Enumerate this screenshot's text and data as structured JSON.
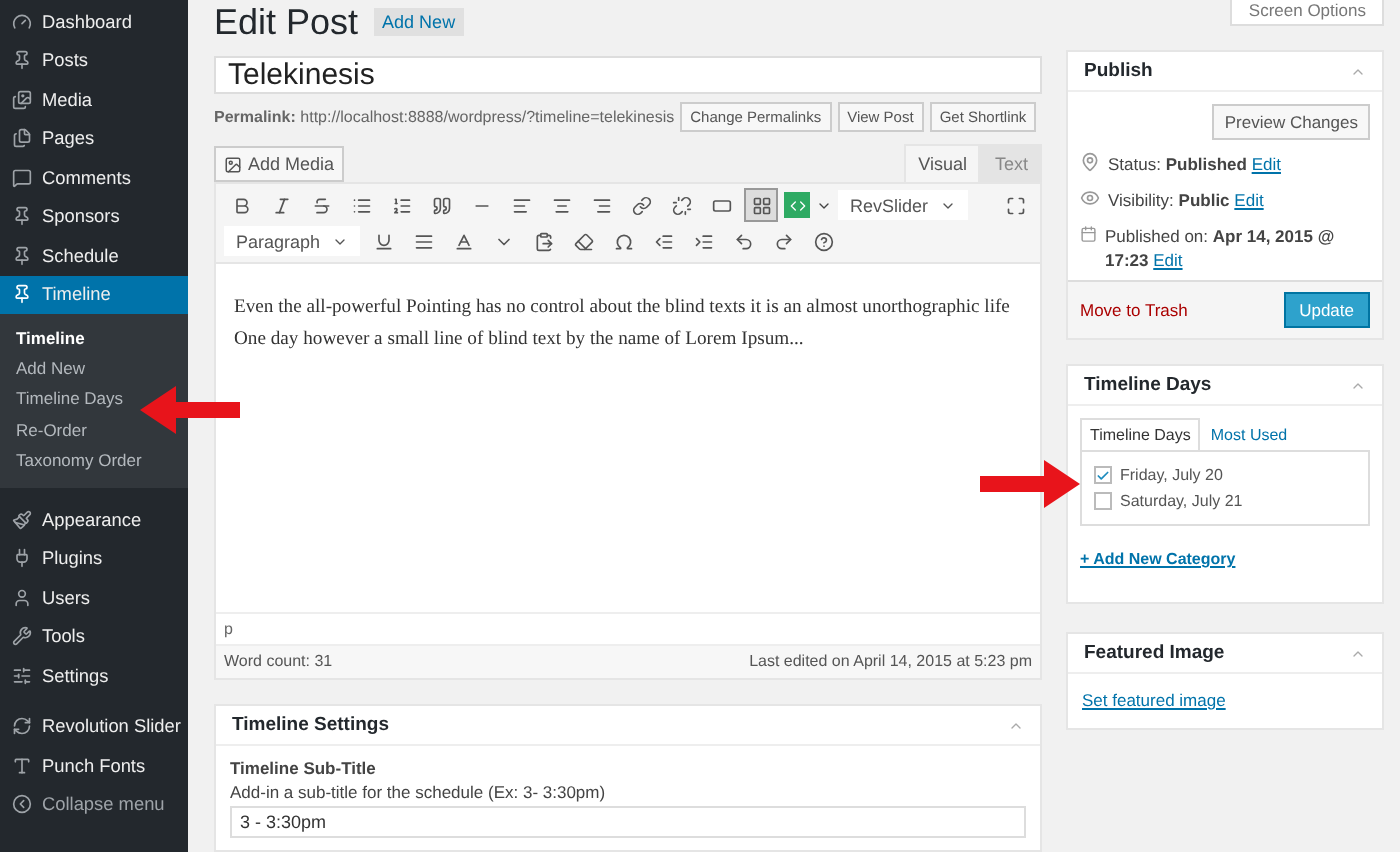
{
  "sidebar": {
    "items": [
      {
        "label": "Dashboard",
        "current": false
      },
      {
        "label": "Posts",
        "current": false
      },
      {
        "label": "Media",
        "current": false
      },
      {
        "label": "Pages",
        "current": false
      },
      {
        "label": "Comments",
        "current": false
      },
      {
        "label": "Sponsors",
        "current": false
      },
      {
        "label": "Schedule",
        "current": false
      },
      {
        "label": "Timeline",
        "current": true,
        "children": [
          {
            "label": "Timeline",
            "current": true
          },
          {
            "label": "Add New",
            "current": false
          },
          {
            "label": "Timeline Days",
            "current": false
          },
          {
            "label": "Re-Order",
            "current": false
          },
          {
            "label": "Taxonomy Order",
            "current": false
          }
        ]
      },
      {
        "label": "Appearance",
        "current": false
      },
      {
        "label": "Plugins",
        "current": false
      },
      {
        "label": "Users",
        "current": false
      },
      {
        "label": "Tools",
        "current": false
      },
      {
        "label": "Settings",
        "current": false
      },
      {
        "label": "Revolution Slider",
        "current": false
      },
      {
        "label": "Punch Fonts",
        "current": false
      }
    ],
    "collapse": "Collapse menu"
  },
  "header": {
    "title": "Edit Post",
    "add_new": "Add New",
    "screen_options": "Screen Options"
  },
  "post_title": {
    "value": "Telekinesis"
  },
  "permalink": {
    "label": "Permalink:",
    "url": "http://localhost:8888/wordpress/?timeline=telekinesis",
    "buttons": [
      "Change Permalinks",
      "View Post",
      "Get Shortlink"
    ]
  },
  "editor": {
    "add_media": "Add Media",
    "tabs": [
      {
        "label": "Visual",
        "selected": true
      },
      {
        "label": "Text",
        "selected": false
      }
    ],
    "plugin_select": "RevSlider",
    "toolbar_toggle_pressed": true,
    "format_select": "Paragraph",
    "content": "Even the all-powerful Pointing has no control about the blind texts it is an almost unorthographic life One day however a small line of blind text by the name of Lorem Ipsum...",
    "path": "p",
    "word_count": "Word count: 31",
    "last_edited": "Last edited on April 14, 2015 at 5:23 pm"
  },
  "timeline_settings": {
    "title": "Timeline Settings",
    "field_label": "Timeline Sub-Title",
    "help": "Add-in a sub-title for the schedule (Ex: 3- 3:30pm)",
    "value": "3 - 3:30pm"
  },
  "publish": {
    "title": "Publish",
    "preview": "Preview Changes",
    "rows": [
      {
        "text": "Status: **Published**",
        "link": "Edit"
      },
      {
        "text": "Visibility: **Public**",
        "link": "Edit"
      },
      {
        "text": "Published on: **Apr 14, 2015 @ 17:23**",
        "link": "Edit"
      }
    ],
    "trash": "Move to Trash",
    "update": "Update"
  },
  "timeline_days": {
    "title": "Timeline Days",
    "tabs": [
      {
        "label": "Timeline Days",
        "selected": true
      },
      {
        "label": "Most Used",
        "selected": false
      }
    ],
    "items": [
      {
        "label": "Friday, July 20",
        "checked": true
      },
      {
        "label": "Saturday, July 21",
        "checked": false
      }
    ],
    "add_new": "+ Add New Category"
  },
  "featured_image": {
    "title": "Featured Image",
    "link": "Set featured image"
  }
}
